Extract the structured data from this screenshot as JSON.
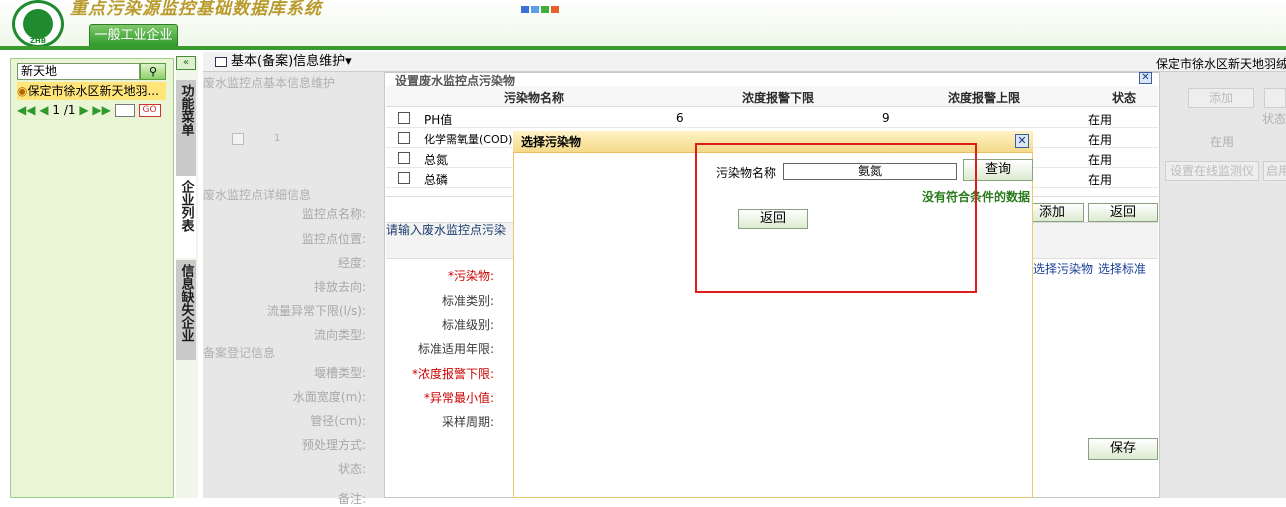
{
  "app": {
    "title": "重点污染源监控基础数据库系统",
    "logo_text": "ZHB",
    "main_tab": "一般工业企业"
  },
  "left": {
    "search_value": "新天地",
    "tree_item": "保定市徐水区新天地羽...",
    "pager": {
      "page": "1",
      "total": "/1"
    }
  },
  "sidetabs": [
    "功能菜单",
    "企业列表",
    "信息缺失企业"
  ],
  "toolbar": {
    "menu": "基本(备案)信息维护▾",
    "company": "保定市徐水区新天地羽绒"
  },
  "bg": {
    "section1": "废水监控点基本信息维护",
    "row_num": "1",
    "section2": "废水监控点详细信息",
    "section3": "备案登记信息",
    "labels": [
      "监控点名称:",
      "监控点位置:",
      "经度:",
      "排放去向:",
      "流量异常下限(l/s):",
      "流向类型:"
    ],
    "labels2": [
      "堰槽类型:",
      "水面宽度(m):",
      "管径(cm):",
      "预处理方式:",
      "状态:",
      "备注:"
    ],
    "right": {
      "add": "添加",
      "status_header": "状态",
      "status": "在用",
      "btn_online": "设置在线监测仪",
      "btn_enable": "启用"
    }
  },
  "panel": {
    "title": "设置废水监控点污染物",
    "headers": [
      "污染物名称",
      "浓度报警下限",
      "浓度报警上限",
      "状态"
    ],
    "rows": [
      {
        "name": "PH值",
        "low": "6",
        "high": "9",
        "status": "在用"
      },
      {
        "name": "化学需氧量(COD)",
        "low": "",
        "high": "",
        "status": "在用"
      },
      {
        "name": "总氮",
        "low": "",
        "high": "",
        "status": "在用"
      },
      {
        "name": "总磷",
        "low": "",
        "high": "",
        "status": "在用"
      }
    ],
    "add": "添加",
    "back": "返回",
    "input_hint": "请输入废水监控点污染",
    "links": {
      "select_pollutant": "选择污染物",
      "select_standard": "选择标准"
    },
    "form_labels": [
      "*污染物:",
      "标准类别:",
      "标准级别:",
      "标准适用年限:",
      "*浓度报警下限:",
      "*异常最小值:",
      "采样周期:"
    ],
    "save": "保存"
  },
  "modal": {
    "title": "选择污染物",
    "field_label": "污染物名称",
    "field_value": "氨氮",
    "query": "查询",
    "no_data": "没有符合条件的数据",
    "back": "返回"
  },
  "colors": {
    "accent": "#3c9b2e",
    "highlight": "#e01b1b",
    "modal_header": "#f5d98a"
  }
}
